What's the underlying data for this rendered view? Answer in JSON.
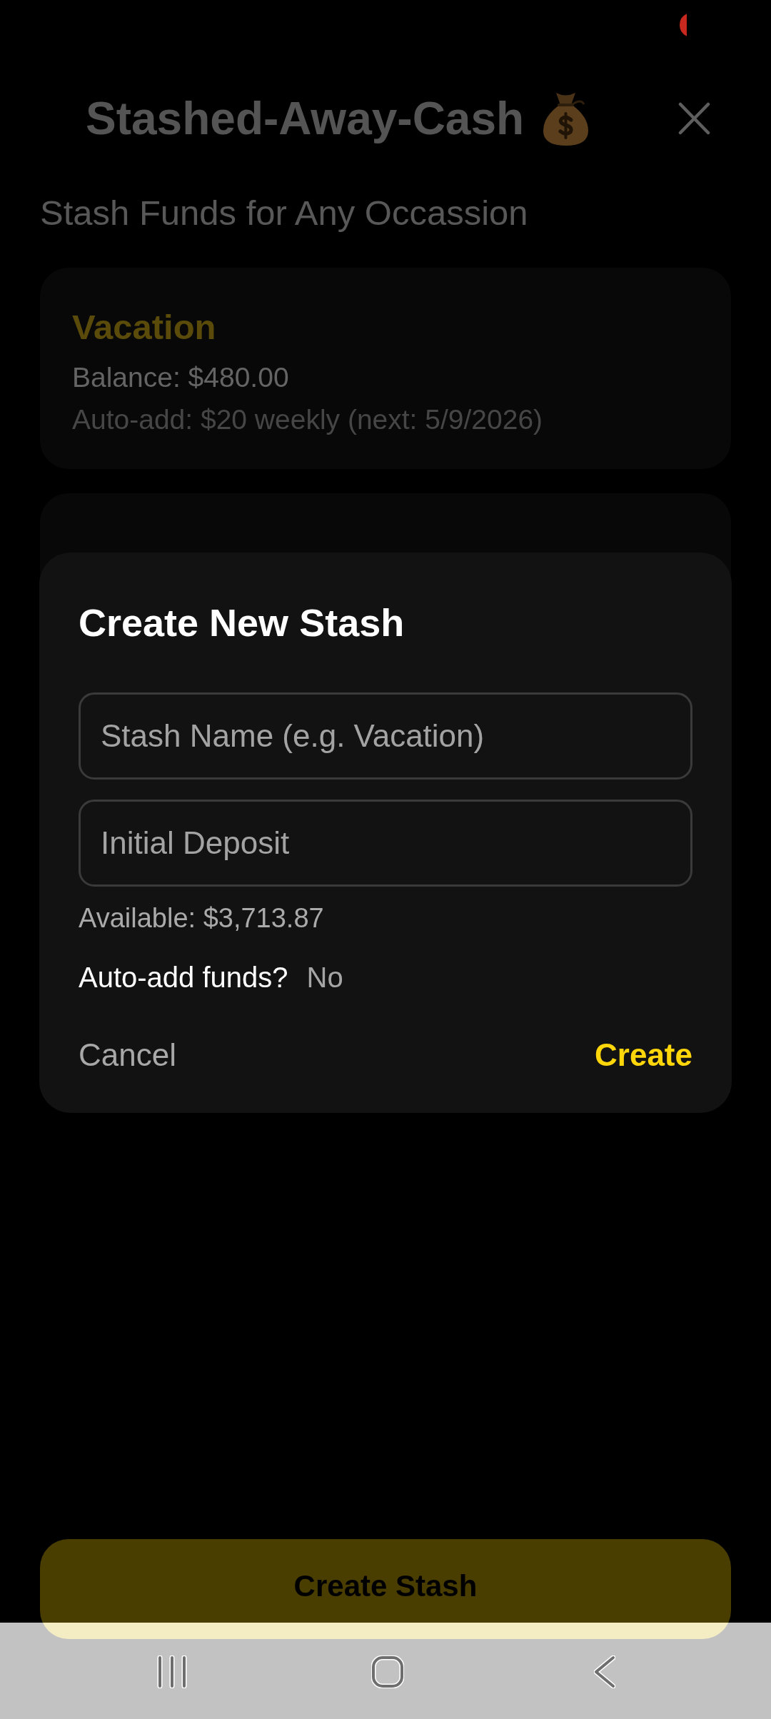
{
  "header": {
    "title": "Stashed-Away-Cash",
    "subtitle": "Stash Funds for Any Occassion"
  },
  "stashes": [
    {
      "name": "Vacation",
      "balance": "Balance: $480.00",
      "auto_add": "Auto-add: $20 weekly (next: 5/9/2026)"
    }
  ],
  "dialog": {
    "title": "Create New Stash",
    "fields": [
      {
        "placeholder": "Stash Name (e.g. Vacation)"
      },
      {
        "placeholder": "Initial Deposit"
      }
    ],
    "available": "Available: $3,713.87",
    "auto_add": {
      "label": "Auto-add funds?",
      "value": "No"
    },
    "buttons": [
      {
        "label": "Cancel",
        "kind": "secondary"
      },
      {
        "label": "Create",
        "kind": "primary"
      }
    ]
  },
  "create_button": {
    "label": "Create Stash"
  }
}
